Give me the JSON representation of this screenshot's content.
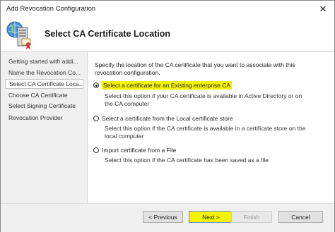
{
  "window": {
    "title": "Add Revocation Configuration",
    "close_glyph": "✕"
  },
  "header": {
    "title": "Select CA Certificate Location",
    "icon": "certificate-server-icon"
  },
  "sidebar": {
    "items": [
      {
        "label": "Getting started with addi..."
      },
      {
        "label": "Name the Revocation Co..."
      },
      {
        "label": "Select CA Certificate Loca..."
      },
      {
        "label": "Choose CA Certificate"
      },
      {
        "label": "Select Signing Certificate"
      },
      {
        "label": "Revocation Provider"
      }
    ],
    "selected_index": 2
  },
  "main": {
    "description": "Specify the location of the CA certificate that you want to associate with this revocation configuration.",
    "options": [
      {
        "label": "Select a certificate for an Existing enterprise CA",
        "description": "Select this option if your CA certificate is available in Active Directory or on the CA computer",
        "checked": true
      },
      {
        "label": "Select a certificate from the Local certificate store",
        "description": "Select this option if the CA certificate is available in a certificate store on the local computer",
        "checked": false
      },
      {
        "label": "Import certificate from a File",
        "description": "Select this option if the CA certificate has been saved as a file",
        "checked": false
      }
    ]
  },
  "footer": {
    "previous_label": "< Previous",
    "next_label": "Next >",
    "finish_label": "Finish",
    "cancel_label": "Cancel"
  },
  "colors": {
    "highlight": "#f4f400",
    "sidebar_bg": "#f0f0f0",
    "footer_bg": "#f0f0f0"
  }
}
